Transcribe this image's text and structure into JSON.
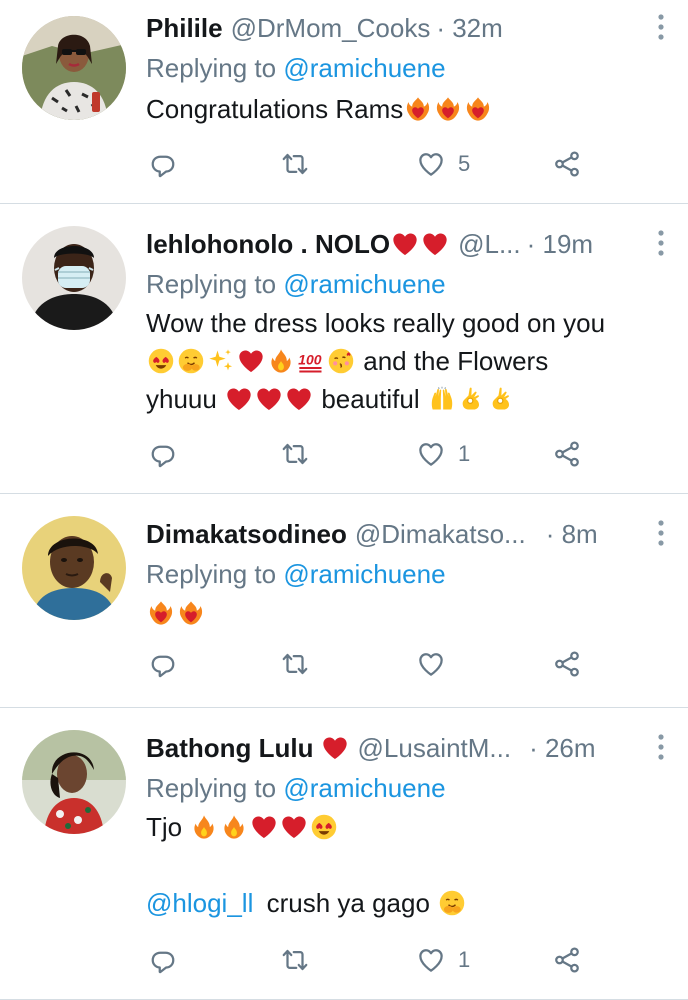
{
  "tweets": [
    {
      "name": "Philile",
      "handle": "@DrMom_Cooks",
      "time": "· 32m",
      "replying_prefix": "Replying to",
      "replying_to": "@ramichuene",
      "text": "Congratulations Rams",
      "likes": "5",
      "avatar": "woman-with-sunglasses-avatar"
    },
    {
      "name": "lehlohonolo . NOLO",
      "handle": "@L...",
      "time": "· 19m",
      "replying_prefix": "Replying to",
      "replying_to": "@ramichuene",
      "text_line1": "Wow the dress looks really good on you",
      "text_line2": "and the Flowers",
      "text_line3a": "yhuuu",
      "text_line3b": "beautiful",
      "likes": "1",
      "avatar": "man-with-face-mask-avatar"
    },
    {
      "name": "Dimakatsodineo",
      "handle": "@Dimakatso...",
      "time": "· 8m",
      "replying_prefix": "Replying to",
      "replying_to": "@ramichuene",
      "likes": "",
      "avatar": "woman-portrait-avatar"
    },
    {
      "name": "Bathong Lulu",
      "handle": "@LusaintM...",
      "time": "· 26m",
      "replying_prefix": "Replying to",
      "replying_to": "@ramichuene",
      "text_line1": "Tjo",
      "mention": "@hlogi_ll",
      "text_line2": "crush ya gago",
      "likes": "1",
      "avatar": "woman-in-floral-dress-avatar"
    }
  ],
  "colors": {
    "accent": "#1b95e0",
    "muted": "#657786",
    "heart_red": "#d61e2b",
    "fire_orange": "#f7861c"
  }
}
